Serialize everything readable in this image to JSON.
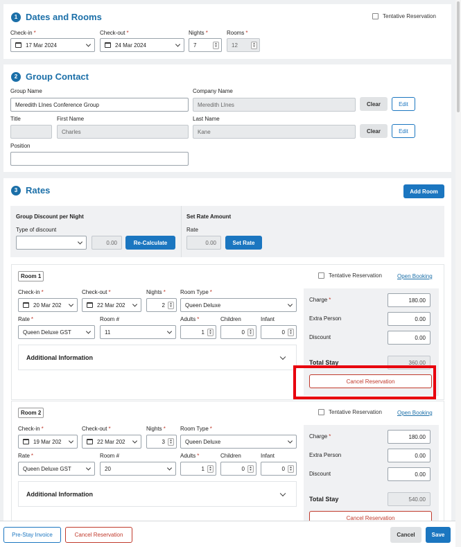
{
  "dates_rooms": {
    "number": "1",
    "title": "Dates and Rooms",
    "tentative_label": "Tentative Reservation",
    "checkin_label": "Check-in",
    "checkin_value": "17 Mar 2024",
    "checkout_label": "Check-out",
    "checkout_value": "24 Mar 2024",
    "nights_label": "Nights",
    "nights_value": "7",
    "rooms_label": "Rooms",
    "rooms_value": "12"
  },
  "group_contact": {
    "number": "2",
    "title": "Group Contact",
    "group_name_label": "Group Name",
    "group_name_value": "Meredith LInes Conference Group",
    "company_name_label": "Company Name",
    "company_name_value": "Meredith LInes",
    "clear_label": "Clear",
    "edit_label": "Edit",
    "title_label": "Title",
    "title_value": "",
    "first_name_label": "First Name",
    "first_name_value": "Charles",
    "last_name_label": "Last Name",
    "last_name_value": "Kane",
    "position_label": "Position",
    "position_value": ""
  },
  "rates": {
    "number": "3",
    "title": "Rates",
    "add_room_label": "Add Room",
    "group_discount_title": "Group Discount per Night",
    "type_of_discount_label": "Type of discount",
    "discount_value": "0.00",
    "recalculate_label": "Re-Calculate",
    "set_rate_title": "Set Rate Amount",
    "rate_label": "Rate",
    "rate_value": "0.00",
    "set_rate_label": "Set Rate"
  },
  "room_labels": {
    "tentative": "Tentative Reservation",
    "open_booking": "Open Booking",
    "checkin": "Check-in",
    "checkout": "Check-out",
    "nights": "Nights",
    "room_type": "Room Type",
    "rate": "Rate",
    "room_no": "Room #",
    "adults": "Adults",
    "children": "Children",
    "infant": "Infant",
    "additional_info": "Additional Information",
    "charge": "Charge",
    "extra_person": "Extra Person",
    "discount": "Discount",
    "total_stay": "Total Stay",
    "cancel": "Cancel Reservation"
  },
  "rooms": [
    {
      "name": "Room 1",
      "checkin": "20 Mar 202",
      "checkout": "22 Mar 202",
      "nights": "2",
      "room_type": "Queen Deluxe",
      "rate": "Queen Deluxe GST",
      "room_no": "11",
      "adults": "1",
      "children": "0",
      "infant": "0",
      "charge": "180.00",
      "extra_person": "0.00",
      "discount": "0.00",
      "total_stay": "360.00"
    },
    {
      "name": "Room 2",
      "checkin": "19 Mar 202",
      "checkout": "22 Mar 202",
      "nights": "3",
      "room_type": "Queen Deluxe",
      "rate": "Queen Deluxe GST",
      "room_no": "20",
      "adults": "1",
      "children": "0",
      "infant": "0",
      "charge": "180.00",
      "extra_person": "0.00",
      "discount": "0.00",
      "total_stay": "540.00"
    }
  ],
  "footer": {
    "pre_stay_invoice": "Pre-Stay Invoice",
    "cancel_reservation": "Cancel Reservation",
    "cancel": "Cancel",
    "save": "Save"
  },
  "colors": {
    "accent": "#1b6fa8",
    "primary_button": "#1b76c0",
    "danger": "#c0392b",
    "highlight": "#e8000d"
  }
}
